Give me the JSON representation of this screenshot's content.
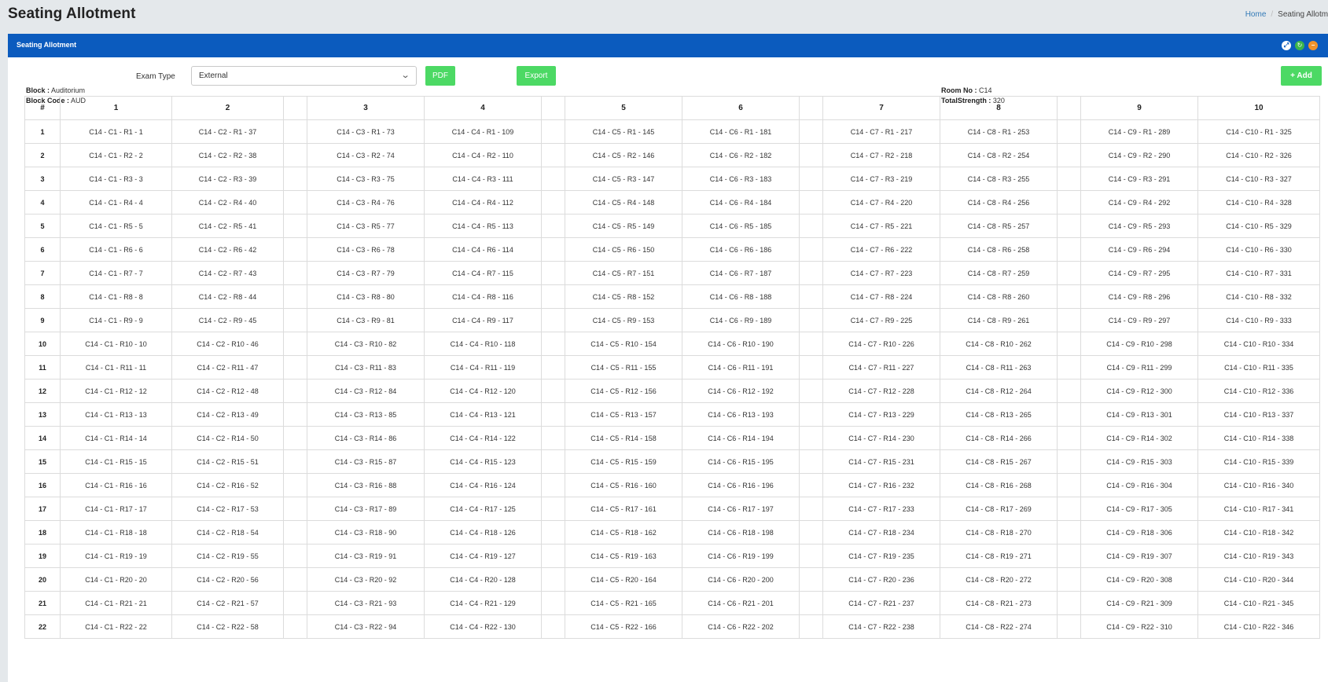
{
  "page": {
    "title": "Seating Allotment"
  },
  "breadcrumb": {
    "home": "Home",
    "separator": "/",
    "current": "Seating Allotment"
  },
  "portlet": {
    "title": "Seating Allotment",
    "tools": [
      "expand-icon",
      "reload-icon",
      "collapse-icon"
    ]
  },
  "filters": {
    "exam_type_label": "Exam Type",
    "exam_type_value": "External",
    "pdf_label": "PDF",
    "export_label": "Export",
    "add_label": "+ Add"
  },
  "info": {
    "block_label": "Block :",
    "block_value": "Auditorium",
    "block_code_label": "Block Code :",
    "block_code_value": "AUD",
    "room_no_label": "Room No :",
    "room_no_value": "C14",
    "total_strength_label": "TotalStrength :",
    "total_strength_value": "320"
  },
  "colors": {
    "header_blue": "#0b5bbe",
    "button_green": "#4cd964",
    "reload_green": "#3cb54a",
    "collapse_orange": "#f0932b"
  },
  "table": {
    "headers": [
      "#",
      "1",
      "2",
      "",
      "3",
      "4",
      "",
      "5",
      "6",
      "",
      "7",
      "8",
      "",
      "9",
      "10"
    ],
    "rows": [
      [
        "1",
        "C14 - C1 - R1 - 1",
        "C14 - C2 - R1 - 37",
        "",
        "C14 - C3 - R1 - 73",
        "C14 - C4 - R1 - 109",
        "",
        "C14 - C5 - R1 - 145",
        "C14 - C6 - R1 - 181",
        "",
        "C14 - C7 - R1 - 217",
        "C14 - C8 - R1 - 253",
        "",
        "C14 - C9 - R1 - 289",
        "C14 - C10 - R1 - 325"
      ],
      [
        "2",
        "C14 - C1 - R2 - 2",
        "C14 - C2 - R2 - 38",
        "",
        "C14 - C3 - R2 - 74",
        "C14 - C4 - R2 - 110",
        "",
        "C14 - C5 - R2 - 146",
        "C14 - C6 - R2 - 182",
        "",
        "C14 - C7 - R2 - 218",
        "C14 - C8 - R2 - 254",
        "",
        "C14 - C9 - R2 - 290",
        "C14 - C10 - R2 - 326"
      ],
      [
        "3",
        "C14 - C1 - R3 - 3",
        "C14 - C2 - R3 - 39",
        "",
        "C14 - C3 - R3 - 75",
        "C14 - C4 - R3 - 111",
        "",
        "C14 - C5 - R3 - 147",
        "C14 - C6 - R3 - 183",
        "",
        "C14 - C7 - R3 - 219",
        "C14 - C8 - R3 - 255",
        "",
        "C14 - C9 - R3 - 291",
        "C14 - C10 - R3 - 327"
      ],
      [
        "4",
        "C14 - C1 - R4 - 4",
        "C14 - C2 - R4 - 40",
        "",
        "C14 - C3 - R4 - 76",
        "C14 - C4 - R4 - 112",
        "",
        "C14 - C5 - R4 - 148",
        "C14 - C6 - R4 - 184",
        "",
        "C14 - C7 - R4 - 220",
        "C14 - C8 - R4 - 256",
        "",
        "C14 - C9 - R4 - 292",
        "C14 - C10 - R4 - 328"
      ],
      [
        "5",
        "C14 - C1 - R5 - 5",
        "C14 - C2 - R5 - 41",
        "",
        "C14 - C3 - R5 - 77",
        "C14 - C4 - R5 - 113",
        "",
        "C14 - C5 - R5 - 149",
        "C14 - C6 - R5 - 185",
        "",
        "C14 - C7 - R5 - 221",
        "C14 - C8 - R5 - 257",
        "",
        "C14 - C9 - R5 - 293",
        "C14 - C10 - R5 - 329"
      ],
      [
        "6",
        "C14 - C1 - R6 - 6",
        "C14 - C2 - R6 - 42",
        "",
        "C14 - C3 - R6 - 78",
        "C14 - C4 - R6 - 114",
        "",
        "C14 - C5 - R6 - 150",
        "C14 - C6 - R6 - 186",
        "",
        "C14 - C7 - R6 - 222",
        "C14 - C8 - R6 - 258",
        "",
        "C14 - C9 - R6 - 294",
        "C14 - C10 - R6 - 330"
      ],
      [
        "7",
        "C14 - C1 - R7 - 7",
        "C14 - C2 - R7 - 43",
        "",
        "C14 - C3 - R7 - 79",
        "C14 - C4 - R7 - 115",
        "",
        "C14 - C5 - R7 - 151",
        "C14 - C6 - R7 - 187",
        "",
        "C14 - C7 - R7 - 223",
        "C14 - C8 - R7 - 259",
        "",
        "C14 - C9 - R7 - 295",
        "C14 - C10 - R7 - 331"
      ],
      [
        "8",
        "C14 - C1 - R8 - 8",
        "C14 - C2 - R8 - 44",
        "",
        "C14 - C3 - R8 - 80",
        "C14 - C4 - R8 - 116",
        "",
        "C14 - C5 - R8 - 152",
        "C14 - C6 - R8 - 188",
        "",
        "C14 - C7 - R8 - 224",
        "C14 - C8 - R8 - 260",
        "",
        "C14 - C9 - R8 - 296",
        "C14 - C10 - R8 - 332"
      ],
      [
        "9",
        "C14 - C1 - R9 - 9",
        "C14 - C2 - R9 - 45",
        "",
        "C14 - C3 - R9 - 81",
        "C14 - C4 - R9 - 117",
        "",
        "C14 - C5 - R9 - 153",
        "C14 - C6 - R9 - 189",
        "",
        "C14 - C7 - R9 - 225",
        "C14 - C8 - R9 - 261",
        "",
        "C14 - C9 - R9 - 297",
        "C14 - C10 - R9 - 333"
      ],
      [
        "10",
        "C14 - C1 - R10 - 10",
        "C14 - C2 - R10 - 46",
        "",
        "C14 - C3 - R10 - 82",
        "C14 - C4 - R10 - 118",
        "",
        "C14 - C5 - R10 - 154",
        "C14 - C6 - R10 - 190",
        "",
        "C14 - C7 - R10 - 226",
        "C14 - C8 - R10 - 262",
        "",
        "C14 - C9 - R10 - 298",
        "C14 - C10 - R10 - 334"
      ],
      [
        "11",
        "C14 - C1 - R11 - 11",
        "C14 - C2 - R11 - 47",
        "",
        "C14 - C3 - R11 - 83",
        "C14 - C4 - R11 - 119",
        "",
        "C14 - C5 - R11 - 155",
        "C14 - C6 - R11 - 191",
        "",
        "C14 - C7 - R11 - 227",
        "C14 - C8 - R11 - 263",
        "",
        "C14 - C9 - R11 - 299",
        "C14 - C10 - R11 - 335"
      ],
      [
        "12",
        "C14 - C1 - R12 - 12",
        "C14 - C2 - R12 - 48",
        "",
        "C14 - C3 - R12 - 84",
        "C14 - C4 - R12 - 120",
        "",
        "C14 - C5 - R12 - 156",
        "C14 - C6 - R12 - 192",
        "",
        "C14 - C7 - R12 - 228",
        "C14 - C8 - R12 - 264",
        "",
        "C14 - C9 - R12 - 300",
        "C14 - C10 - R12 - 336"
      ],
      [
        "13",
        "C14 - C1 - R13 - 13",
        "C14 - C2 - R13 - 49",
        "",
        "C14 - C3 - R13 - 85",
        "C14 - C4 - R13 - 121",
        "",
        "C14 - C5 - R13 - 157",
        "C14 - C6 - R13 - 193",
        "",
        "C14 - C7 - R13 - 229",
        "C14 - C8 - R13 - 265",
        "",
        "C14 - C9 - R13 - 301",
        "C14 - C10 - R13 - 337"
      ],
      [
        "14",
        "C14 - C1 - R14 - 14",
        "C14 - C2 - R14 - 50",
        "",
        "C14 - C3 - R14 - 86",
        "C14 - C4 - R14 - 122",
        "",
        "C14 - C5 - R14 - 158",
        "C14 - C6 - R14 - 194",
        "",
        "C14 - C7 - R14 - 230",
        "C14 - C8 - R14 - 266",
        "",
        "C14 - C9 - R14 - 302",
        "C14 - C10 - R14 - 338"
      ],
      [
        "15",
        "C14 - C1 - R15 - 15",
        "C14 - C2 - R15 - 51",
        "",
        "C14 - C3 - R15 - 87",
        "C14 - C4 - R15 - 123",
        "",
        "C14 - C5 - R15 - 159",
        "C14 - C6 - R15 - 195",
        "",
        "C14 - C7 - R15 - 231",
        "C14 - C8 - R15 - 267",
        "",
        "C14 - C9 - R15 - 303",
        "C14 - C10 - R15 - 339"
      ],
      [
        "16",
        "C14 - C1 - R16 - 16",
        "C14 - C2 - R16 - 52",
        "",
        "C14 - C3 - R16 - 88",
        "C14 - C4 - R16 - 124",
        "",
        "C14 - C5 - R16 - 160",
        "C14 - C6 - R16 - 196",
        "",
        "C14 - C7 - R16 - 232",
        "C14 - C8 - R16 - 268",
        "",
        "C14 - C9 - R16 - 304",
        "C14 - C10 - R16 - 340"
      ],
      [
        "17",
        "C14 - C1 - R17 - 17",
        "C14 - C2 - R17 - 53",
        "",
        "C14 - C3 - R17 - 89",
        "C14 - C4 - R17 - 125",
        "",
        "C14 - C5 - R17 - 161",
        "C14 - C6 - R17 - 197",
        "",
        "C14 - C7 - R17 - 233",
        "C14 - C8 - R17 - 269",
        "",
        "C14 - C9 - R17 - 305",
        "C14 - C10 - R17 - 341"
      ],
      [
        "18",
        "C14 - C1 - R18 - 18",
        "C14 - C2 - R18 - 54",
        "",
        "C14 - C3 - R18 - 90",
        "C14 - C4 - R18 - 126",
        "",
        "C14 - C5 - R18 - 162",
        "C14 - C6 - R18 - 198",
        "",
        "C14 - C7 - R18 - 234",
        "C14 - C8 - R18 - 270",
        "",
        "C14 - C9 - R18 - 306",
        "C14 - C10 - R18 - 342"
      ],
      [
        "19",
        "C14 - C1 - R19 - 19",
        "C14 - C2 - R19 - 55",
        "",
        "C14 - C3 - R19 - 91",
        "C14 - C4 - R19 - 127",
        "",
        "C14 - C5 - R19 - 163",
        "C14 - C6 - R19 - 199",
        "",
        "C14 - C7 - R19 - 235",
        "C14 - C8 - R19 - 271",
        "",
        "C14 - C9 - R19 - 307",
        "C14 - C10 - R19 - 343"
      ],
      [
        "20",
        "C14 - C1 - R20 - 20",
        "C14 - C2 - R20 - 56",
        "",
        "C14 - C3 - R20 - 92",
        "C14 - C4 - R20 - 128",
        "",
        "C14 - C5 - R20 - 164",
        "C14 - C6 - R20 - 200",
        "",
        "C14 - C7 - R20 - 236",
        "C14 - C8 - R20 - 272",
        "",
        "C14 - C9 - R20 - 308",
        "C14 - C10 - R20 - 344"
      ],
      [
        "21",
        "C14 - C1 - R21 - 21",
        "C14 - C2 - R21 - 57",
        "",
        "C14 - C3 - R21 - 93",
        "C14 - C4 - R21 - 129",
        "",
        "C14 - C5 - R21 - 165",
        "C14 - C6 - R21 - 201",
        "",
        "C14 - C7 - R21 - 237",
        "C14 - C8 - R21 - 273",
        "",
        "C14 - C9 - R21 - 309",
        "C14 - C10 - R21 - 345"
      ],
      [
        "22",
        "C14 - C1 - R22 - 22",
        "C14 - C2 - R22 - 58",
        "",
        "C14 - C3 - R22 - 94",
        "C14 - C4 - R22 - 130",
        "",
        "C14 - C5 - R22 - 166",
        "C14 - C6 - R22 - 202",
        "",
        "C14 - C7 - R22 - 238",
        "C14 - C8 - R22 - 274",
        "",
        "C14 - C9 - R22 - 310",
        "C14 - C10 - R22 - 346"
      ]
    ]
  }
}
